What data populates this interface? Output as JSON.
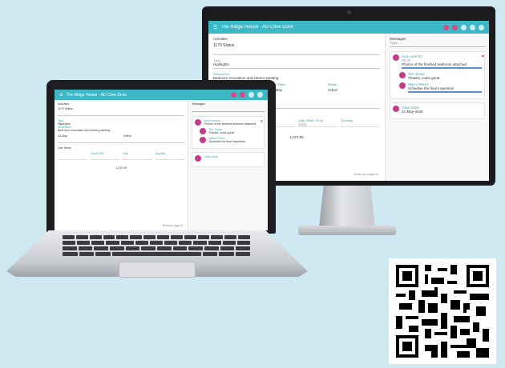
{
  "monitor_app": {
    "title": "The Ridge House - AD   Clive Dock",
    "left": {
      "breadcrumb": "Activities",
      "record_title": "1170 Status",
      "field1_label": "Type",
      "field1_value": "Highlights",
      "field2_label": "Description",
      "field2_value": "Bedroom renovation and interior painting",
      "row_labels": [
        "Contractor",
        "Start Date",
        "Status"
      ],
      "row_values": [
        "",
        "24 May",
        "Active"
      ],
      "row2_label": "Created",
      "row2_value": "21-May-2025",
      "table_label": "Line Items",
      "table_headers": [
        "",
        "Cost (EUR)",
        "Date (Start / End)",
        "Quantity"
      ],
      "table_rows": [
        [
          "",
          "1,010",
          "1,072",
          ""
        ]
      ],
      "total_label": "1,072.00",
      "footer": "Items per page 10"
    },
    "right": {
      "header": "Messages",
      "search_placeholder": "Type...",
      "messages": [
        {
          "name": "Ana Lorenzo",
          "time": "09:42",
          "text": "Photos of the finished bedroom attached"
        },
        {
          "name": "Tim Jones",
          "time": "10:05",
          "text": "Thanks, looks great"
        },
        {
          "name": "Marco Pérez",
          "time": "11:20",
          "text": "Schedule the final inspection"
        }
      ],
      "bottom_name": "Clive Dock",
      "bottom_text": "21-May-2025"
    }
  },
  "laptop_app": {
    "title": "The Ridge House - AD   Clive Dock",
    "left": {
      "breadcrumb": "Activities",
      "record_title": "1170 Status",
      "field1_label": "Type",
      "field1_value": "Highlights",
      "field2_label": "Description",
      "field2_value": "Bedroom renovation and interior painting",
      "row_values": [
        "24 May",
        "Active"
      ],
      "table_label": "Line Items",
      "table_headers": [
        "",
        "Cost (EUR)",
        "Date",
        "Quantity"
      ],
      "total_label": "1,072.00",
      "footer": "Items per page 10"
    },
    "right": {
      "header": "Messages",
      "messages": [
        {
          "name": "Ana Lorenzo",
          "text": "Photos of the finished bedroom attached"
        },
        {
          "name": "Tim Jones",
          "text": "Thanks, looks great"
        },
        {
          "name": "Marco Pérez",
          "text": "Schedule the final inspection"
        }
      ],
      "bottom_name": "Clive Dock"
    }
  },
  "colors": {
    "background": "#cfe9f3",
    "app_bar": "#3db8c6",
    "accent": "#c33b8a"
  },
  "icons": [
    "menu-icon",
    "notification-icon",
    "search-icon",
    "settings-icon",
    "heart-icon",
    "qr-code-icon"
  ]
}
